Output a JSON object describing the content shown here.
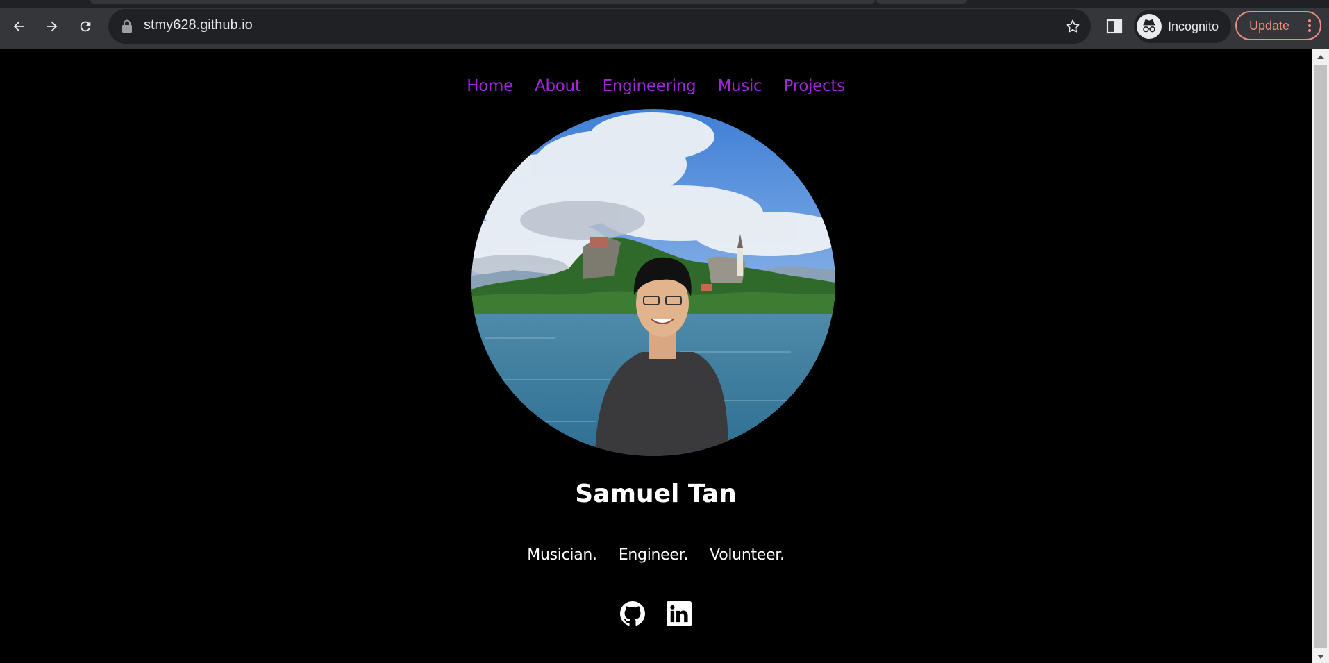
{
  "browser": {
    "url": "stmy628.github.io",
    "profile_label": "Incognito",
    "update_label": "Update",
    "icons": {
      "back": "arrow-left-icon",
      "forward": "arrow-right-icon",
      "reload": "reload-icon",
      "lock": "lock-icon",
      "bookmark": "star-icon",
      "side_panel": "side-panel-icon",
      "profile": "incognito-icon",
      "menu": "kebab-menu-icon"
    },
    "colors": {
      "toolbar": "#35363a",
      "omnibox": "#202124",
      "update_accent": "#f28b82"
    }
  },
  "site": {
    "nav": [
      {
        "label": "Home"
      },
      {
        "label": "About"
      },
      {
        "label": "Engineering"
      },
      {
        "label": "Music"
      },
      {
        "label": "Projects"
      }
    ],
    "name": "Samuel Tan",
    "taglines": [
      "Musician.",
      "Engineer.",
      "Volunteer."
    ],
    "socials": [
      {
        "icon": "github-icon"
      },
      {
        "icon": "linkedin-icon"
      }
    ],
    "colors": {
      "background": "#000000",
      "nav_link": "#9f26d9",
      "text": "#ffffff"
    }
  }
}
